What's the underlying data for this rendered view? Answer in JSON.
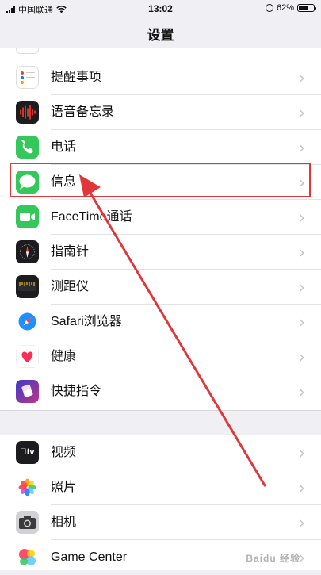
{
  "status_bar": {
    "carrier": "中国联通",
    "time": "13:02",
    "battery": "62%",
    "battery_level": 0.62
  },
  "header": {
    "title": "设置"
  },
  "group1": [
    {
      "label": "提醒事项",
      "icon": "reminders-icon"
    },
    {
      "label": "语音备忘录",
      "icon": "voice-memos-icon"
    },
    {
      "label": "电话",
      "icon": "phone-icon"
    },
    {
      "label": "信息",
      "icon": "messages-icon",
      "highlighted": true
    },
    {
      "label": "FaceTime通话",
      "icon": "facetime-icon"
    },
    {
      "label": "指南针",
      "icon": "compass-icon"
    },
    {
      "label": "测距仪",
      "icon": "measure-icon"
    },
    {
      "label": "Safari浏览器",
      "icon": "safari-icon"
    },
    {
      "label": "健康",
      "icon": "health-icon"
    },
    {
      "label": "快捷指令",
      "icon": "shortcuts-icon"
    }
  ],
  "group2": [
    {
      "label": "视频",
      "icon": "tv-icon"
    },
    {
      "label": "照片",
      "icon": "photos-icon"
    },
    {
      "label": "相机",
      "icon": "camera-icon"
    },
    {
      "label": "Game Center",
      "icon": "game-center-icon"
    }
  ],
  "chevron": "›",
  "tv_icon_text": "tv",
  "watermark": "Baidu 经验",
  "colors": {
    "highlight": "#e0383a",
    "chevron": "#c4c4c9",
    "background": "#efeff4"
  }
}
